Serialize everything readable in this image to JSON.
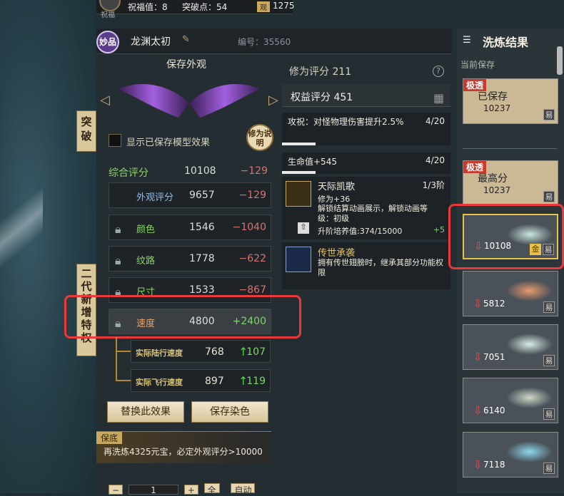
{
  "topbar": {
    "blessing": "祝福值：8",
    "breakpoint": "突破点：54",
    "obs_tag": "观",
    "obs_value": "1275",
    "avatar_label": "祝福"
  },
  "header": {
    "quality": "妙品",
    "name": "龙渊太初",
    "id": "编号：35560"
  },
  "preview": {
    "title": "保存外观",
    "checkbox_label": "显示已保存模型效果",
    "mod_btn": "修为说明"
  },
  "sidetabs": {
    "breakthrough": "突破",
    "new_features": "二代新增特权"
  },
  "scores": {
    "total": {
      "label": "综合评分",
      "value": "10108",
      "delta": "−129"
    },
    "appearance": {
      "label": "外观评分",
      "value": "9657",
      "delta": "−129"
    },
    "color": {
      "label": "颜色",
      "value": "1546",
      "delta": "−1040"
    },
    "texture": {
      "label": "纹路",
      "value": "1778",
      "delta": "−622"
    },
    "size": {
      "label": "尺寸",
      "value": "1533",
      "delta": "−867"
    },
    "speed": {
      "label": "速度",
      "value": "4800",
      "delta": "+2400"
    },
    "land_speed": {
      "label": "实际陆行速度",
      "value": "768",
      "delta": "107"
    },
    "fly_speed": {
      "label": "实际飞行速度",
      "value": "897",
      "delta": "119"
    }
  },
  "actions": {
    "replace": "替换此效果",
    "save_dye": "保存染色"
  },
  "guarantee": {
    "tag": "保底",
    "text": "再洗炼4325元宝，必定外观评分>10000"
  },
  "bottom": {
    "minus": "−",
    "qty": "1",
    "plus": "+",
    "all": "全",
    "auto": "自动"
  },
  "rightinfo": {
    "cultivation": "修为评分  211",
    "rights": "权益评分 451",
    "entry1": {
      "text": "攻祝：对怪物理伤害提升2.5%",
      "count": "4/20",
      "progress": 0.2
    },
    "entry2": {
      "text": "生命值+545",
      "count": "4/20",
      "progress": 0.2
    },
    "skill1": {
      "name": "天际凯歌",
      "stage": "1/3阶",
      "desc1": "修为+36",
      "desc2": "解锁结算动画展示，解锁动画等级：初级",
      "upgrade": "升阶培养值:374/15000",
      "plus": "+5"
    },
    "skill2": {
      "name": "传世承袭",
      "desc": "拥有传世翅膀时，继承其部分功能权限"
    }
  },
  "results": {
    "title": "洗炼结果",
    "current_label": "当前保存",
    "cards": [
      {
        "tag": "极透",
        "label": "已保存",
        "value": "10237",
        "badge": "易"
      },
      {
        "tag": "极透",
        "label": "最高分",
        "value": "10237",
        "badge": "易"
      },
      {
        "value": "10108",
        "gold": "金",
        "badge": "易"
      },
      {
        "value": "5812",
        "badge": "易"
      },
      {
        "value": "7051",
        "badge": "易"
      },
      {
        "value": "6140",
        "badge": "易"
      },
      {
        "value": "7118",
        "badge": "易"
      }
    ]
  }
}
